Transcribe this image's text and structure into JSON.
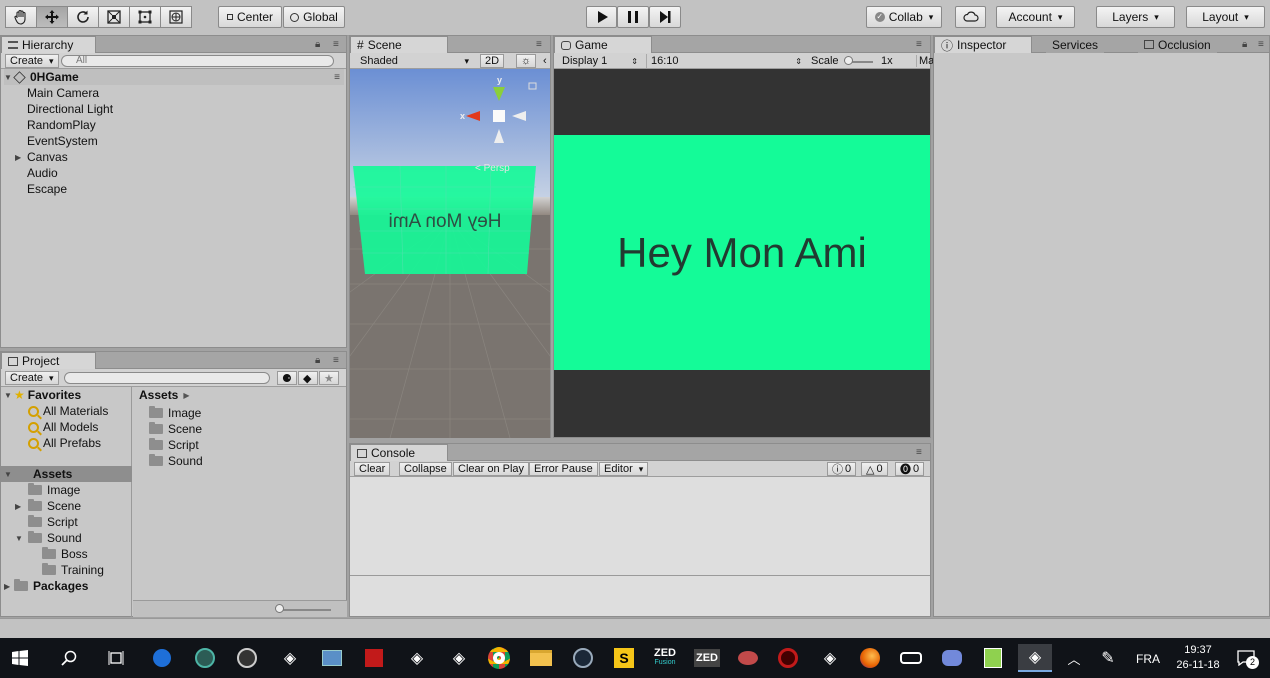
{
  "toolbar": {
    "pivot": "Center",
    "space": "Global",
    "collab": "Collab",
    "account": "Account",
    "layers": "Layers",
    "layout": "Layout"
  },
  "hierarchy": {
    "tab": "Hierarchy",
    "create": "Create",
    "search_placeholder": "All",
    "scene_name": "0HGame",
    "items": [
      "Main Camera",
      "Directional Light",
      "RandomPlay",
      "EventSystem",
      "Canvas",
      "Audio",
      "Escape"
    ]
  },
  "scene": {
    "tab": "Scene",
    "shading": "Shaded",
    "mode_2d": "2D",
    "persp": "< Persp",
    "gizmo_x": "x",
    "gizmo_y": "y",
    "mirrored_text": "Hey Mon Ami"
  },
  "game": {
    "tab": "Game",
    "display": "Display 1",
    "aspect": "16:10",
    "scale_label": "Scale",
    "scale_value": "1x",
    "maximize_abbr": "Ma",
    "text": "Hey Mon Ami"
  },
  "inspector": {
    "tabs": [
      "Inspector",
      "Services",
      "Occlusion"
    ]
  },
  "project": {
    "tab": "Project",
    "create": "Create",
    "favorites": "Favorites",
    "fav_items": [
      "All Materials",
      "All Models",
      "All Prefabs"
    ],
    "assets_label": "Assets",
    "assets_children": [
      "Image",
      "Scene",
      "Script",
      "Sound"
    ],
    "sound_children": [
      "Boss",
      "Training"
    ],
    "packages": "Packages",
    "breadcrumb": "Assets",
    "grid_items": [
      "Image",
      "Scene",
      "Script",
      "Sound"
    ]
  },
  "console": {
    "tab": "Console",
    "buttons": [
      "Clear",
      "Collapse",
      "Clear on Play",
      "Error Pause",
      "Editor"
    ],
    "info_count": "0",
    "warn_count": "0",
    "error_count": "0"
  },
  "taskbar": {
    "zed_fusion_1": "ZED",
    "zed_fusion_2": "Fusion",
    "zed": "ZED",
    "s_label": "S",
    "language": "FRA",
    "time": "19:37",
    "date": "26-11-18",
    "notification_count": "2"
  },
  "colors": {
    "game_green": "#14fb98",
    "game_text": "#223a31",
    "taskbar": "#101318"
  }
}
